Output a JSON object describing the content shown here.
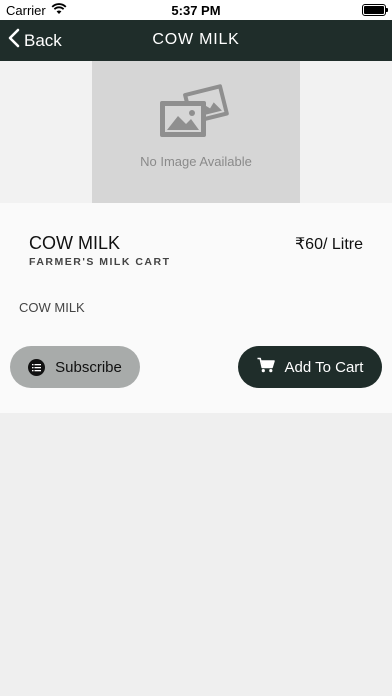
{
  "status_bar": {
    "carrier": "Carrier",
    "time": "5:37 PM"
  },
  "nav": {
    "back_label": "Back",
    "title": "COW MILK"
  },
  "image": {
    "placeholder_text": "No Image Available"
  },
  "product": {
    "name": "COW MILK",
    "seller": "FARMER'S MILK CART",
    "price": "₹60/ Litre",
    "description": "COW MILK"
  },
  "actions": {
    "subscribe_label": "Subscribe",
    "add_to_cart_label": "Add To Cart"
  },
  "colors": {
    "nav_bg": "#1f2d2a",
    "subscribe_bg": "#a8abaa",
    "cart_bg": "#1f2d2a",
    "page_bg": "#efefef"
  },
  "icons": [
    "wifi-icon",
    "battery-icon",
    "chevron-left-icon",
    "photo-placeholder-icon",
    "list-icon",
    "cart-icon"
  ]
}
